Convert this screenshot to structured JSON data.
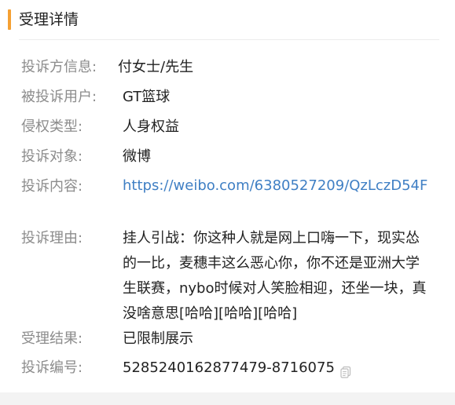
{
  "header": {
    "title": "受理详情"
  },
  "details": {
    "complainant_label": "投诉方信息:",
    "complainant_value": "付女士/先生",
    "accused_label": "被投诉用户:",
    "accused_value": "GT篮球",
    "type_label": "侵权类型:",
    "type_value": "人身权益",
    "object_label": "投诉对象:",
    "object_value": "微博",
    "content_label": "投诉内容:",
    "content_value": "https://weibo.com/6380527209/QzLczD54F",
    "reason_label": "投诉理由:",
    "reason_value": "挂人引战：你这种人就是网上口嗨一下，现实怂的一比，麦穗丰这么恶心你，你不还是亚洲大学生联赛，nybo时候对人笑脸相迎，还坐一块，真没啥意思[哈哈][哈哈][哈哈]",
    "result_label": "受理结果:",
    "result_value": "已限制展示",
    "number_label": "投诉编号:",
    "number_value": "5285240162877479-8716075"
  },
  "icons": {
    "copy": "copy-icon"
  },
  "colors": {
    "accent": "#f5a033",
    "link": "#3f7fc4",
    "label": "#8c8c8c",
    "text": "#222222"
  }
}
